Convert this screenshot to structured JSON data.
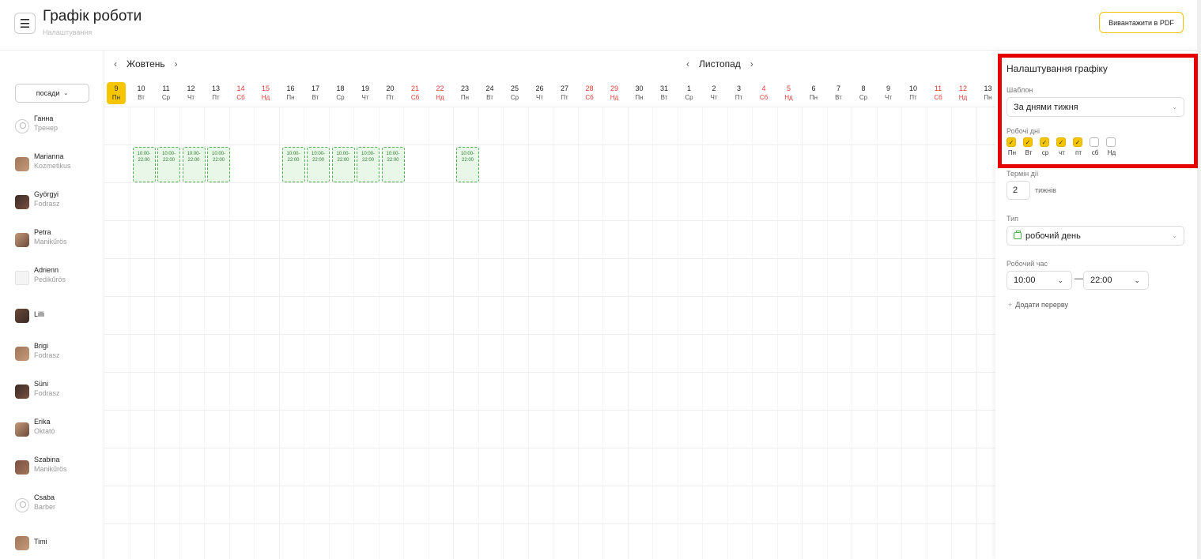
{
  "header": {
    "menu_icon": "☰",
    "title": "Графік роботи",
    "subtitle": "Налаштування",
    "pdf_button": "Вивантажити в PDF"
  },
  "sidebar": {
    "position_filter": "посади",
    "employees": [
      {
        "name": "Ганна",
        "role": "Тренер",
        "avatar": "placeholder"
      },
      {
        "name": "Marianna",
        "role": "Kozmetikus",
        "avatar": "photo"
      },
      {
        "name": "Györgyi",
        "role": "Fodrasz",
        "avatar": "photo"
      },
      {
        "name": "Petra",
        "role": "Manikűrös",
        "avatar": "photo"
      },
      {
        "name": "Adrienn",
        "role": "Pedikűrös",
        "avatar": "document"
      },
      {
        "name": "Lilli",
        "role": "",
        "avatar": "photo"
      },
      {
        "name": "Brigi",
        "role": "Fodrasz",
        "avatar": "photo"
      },
      {
        "name": "Süni",
        "role": "Fodrasz",
        "avatar": "photo"
      },
      {
        "name": "Erika",
        "role": "Oktató",
        "avatar": "photo"
      },
      {
        "name": "Szabina",
        "role": "Manikűrös",
        "avatar": "photo"
      },
      {
        "name": "Csaba",
        "role": "Barber",
        "avatar": "placeholder"
      },
      {
        "name": "Timi",
        "role": "",
        "avatar": "photo"
      }
    ]
  },
  "calendar": {
    "months": [
      {
        "label": "Жовтень"
      },
      {
        "label": "Листопад"
      }
    ],
    "prev_arrow": "‹",
    "next_arrow": "›",
    "days": [
      {
        "num": "9",
        "wd": "Пн",
        "weekend": false,
        "today": true
      },
      {
        "num": "10",
        "wd": "Вт",
        "weekend": false
      },
      {
        "num": "11",
        "wd": "Ср",
        "weekend": false
      },
      {
        "num": "12",
        "wd": "Чт",
        "weekend": false
      },
      {
        "num": "13",
        "wd": "Пт",
        "weekend": false
      },
      {
        "num": "14",
        "wd": "Сб",
        "weekend": true
      },
      {
        "num": "15",
        "wd": "Нд",
        "weekend": true
      },
      {
        "num": "16",
        "wd": "Пн",
        "weekend": false
      },
      {
        "num": "17",
        "wd": "Вт",
        "weekend": false
      },
      {
        "num": "18",
        "wd": "Ср",
        "weekend": false
      },
      {
        "num": "19",
        "wd": "Чт",
        "weekend": false
      },
      {
        "num": "20",
        "wd": "Пт",
        "weekend": false
      },
      {
        "num": "21",
        "wd": "Сб",
        "weekend": true
      },
      {
        "num": "22",
        "wd": "Нд",
        "weekend": true
      },
      {
        "num": "23",
        "wd": "Пн",
        "weekend": false
      },
      {
        "num": "24",
        "wd": "Вт",
        "weekend": false
      },
      {
        "num": "25",
        "wd": "Ср",
        "weekend": false
      },
      {
        "num": "26",
        "wd": "Чт",
        "weekend": false
      },
      {
        "num": "27",
        "wd": "Пт",
        "weekend": false
      },
      {
        "num": "28",
        "wd": "Сб",
        "weekend": true
      },
      {
        "num": "29",
        "wd": "Нд",
        "weekend": true
      },
      {
        "num": "30",
        "wd": "Пн",
        "weekend": false
      },
      {
        "num": "31",
        "wd": "Вт",
        "weekend": false
      },
      {
        "num": "1",
        "wd": "Ср",
        "weekend": false
      },
      {
        "num": "2",
        "wd": "Чт",
        "weekend": false
      },
      {
        "num": "3",
        "wd": "Пт",
        "weekend": false
      },
      {
        "num": "4",
        "wd": "Сб",
        "weekend": true
      },
      {
        "num": "5",
        "wd": "Нд",
        "weekend": true
      },
      {
        "num": "6",
        "wd": "Пн",
        "weekend": false
      },
      {
        "num": "7",
        "wd": "Вт",
        "weekend": false
      },
      {
        "num": "8",
        "wd": "Ср",
        "weekend": false
      },
      {
        "num": "9",
        "wd": "Чт",
        "weekend": false
      },
      {
        "num": "10",
        "wd": "Пт",
        "weekend": false
      },
      {
        "num": "11",
        "wd": "Сб",
        "weekend": true
      },
      {
        "num": "12",
        "wd": "Нд",
        "weekend": true
      },
      {
        "num": "13",
        "wd": "Пн",
        "weekend": false
      }
    ],
    "shift_row": 1,
    "shift_days": [
      1,
      2,
      3,
      4,
      7,
      8,
      9,
      10,
      11,
      14
    ],
    "shift_text": "10:00-\n22:00",
    "colors": {
      "today": "#f5c500",
      "weekend": "#e53935",
      "shift_border": "#4caf50",
      "shift_bg": "#e9f7e9"
    }
  },
  "panel": {
    "title": "Налаштування графіку",
    "template_label": "Шаблон",
    "template_value": "За днями тижня",
    "working_days_label": "Робочі дні",
    "working_days": [
      {
        "label": "Пн",
        "checked": true
      },
      {
        "label": "Вт",
        "checked": true
      },
      {
        "label": "ср",
        "checked": true
      },
      {
        "label": "чт",
        "checked": true
      },
      {
        "label": "пт",
        "checked": true
      },
      {
        "label": "сб",
        "checked": false
      },
      {
        "label": "Нд",
        "checked": false
      }
    ],
    "term_label": "Термін дії",
    "term_value": "2",
    "term_unit": "тижнів",
    "type_label": "Тип",
    "type_value": "робочий день",
    "hours_label": "Робочий час",
    "time_from": "10:00",
    "time_to": "22:00",
    "time_separator": "—",
    "add_break": "Додати перерву",
    "add_break_icon": "+",
    "highlight_color": "#e60000"
  }
}
